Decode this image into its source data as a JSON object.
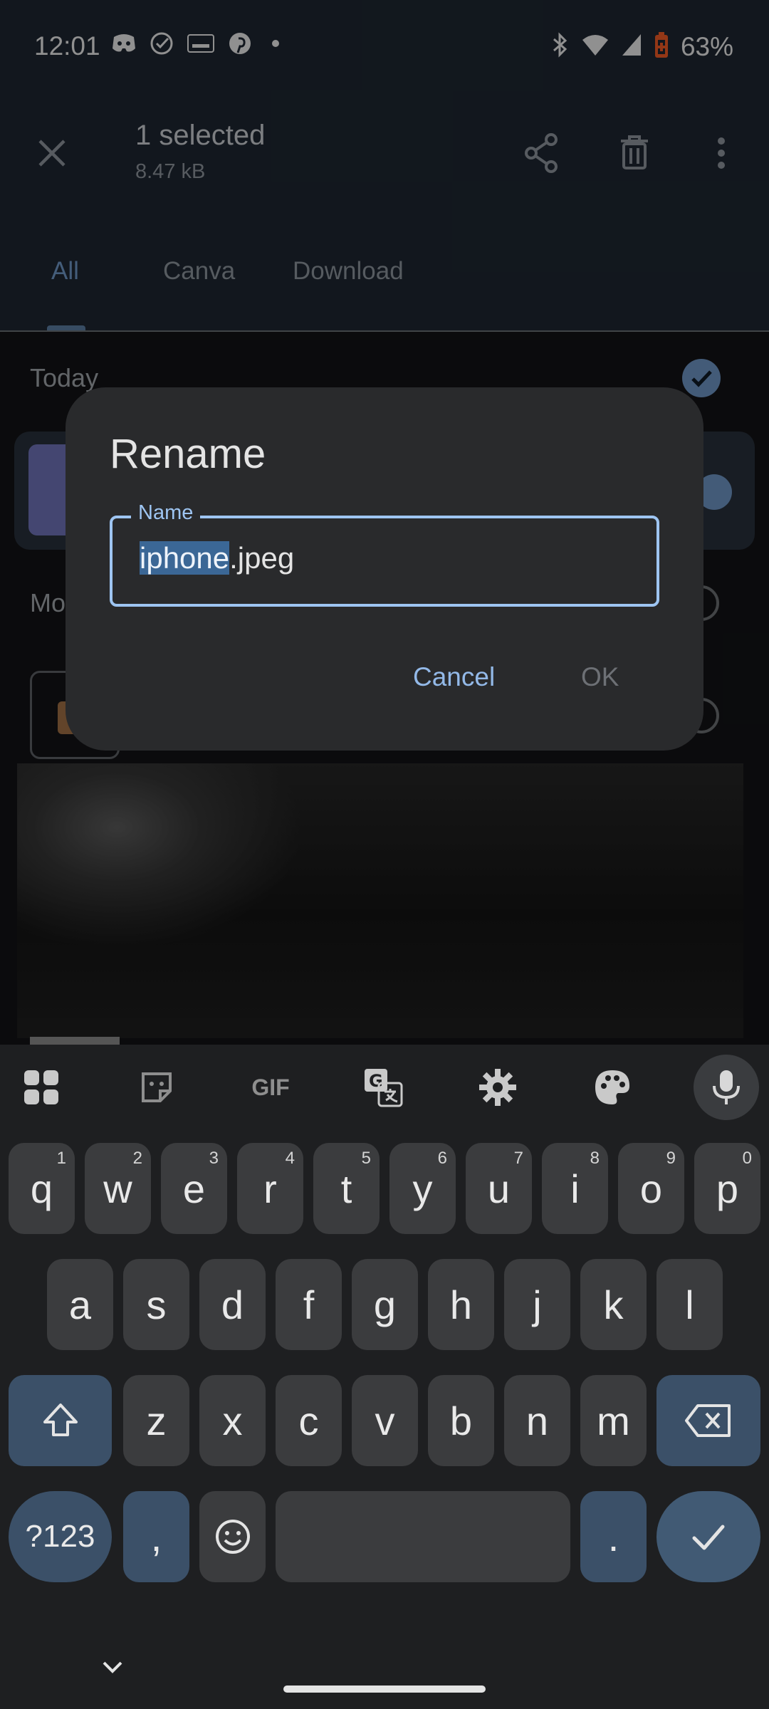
{
  "status_bar": {
    "time": "12:01",
    "battery": "63%",
    "notification_icons": [
      "discord-icon",
      "check-circle-icon",
      "temu-icon",
      "pinterest-icon",
      "dot-icon"
    ],
    "system_icons": [
      "bluetooth-icon",
      "wifi-icon",
      "signal-icon",
      "battery-saver-icon"
    ]
  },
  "action_bar": {
    "title": "1 selected",
    "subtitle": "8.47 kB",
    "actions": [
      "close-icon",
      "share-icon",
      "delete-icon",
      "more-vert-icon"
    ]
  },
  "tabs": [
    {
      "label": "All",
      "active": true
    },
    {
      "label": "Canva",
      "active": false
    },
    {
      "label": "Download",
      "active": false
    }
  ],
  "list": {
    "section_today": "Today",
    "section_more": "Mo"
  },
  "dialog": {
    "title": "Rename",
    "field_label": "Name",
    "value_selected": "iphone",
    "value_rest": ".jpeg",
    "cancel_label": "Cancel",
    "ok_label": "OK"
  },
  "keyboard": {
    "toolbar": [
      "apps-grid-icon",
      "sticker-icon",
      "gif-icon",
      "translate-icon",
      "settings-icon",
      "palette-icon",
      "mic-icon"
    ],
    "gif_label": "GIF",
    "row1": [
      {
        "key": "q",
        "hint": "1"
      },
      {
        "key": "w",
        "hint": "2"
      },
      {
        "key": "e",
        "hint": "3"
      },
      {
        "key": "r",
        "hint": "4"
      },
      {
        "key": "t",
        "hint": "5"
      },
      {
        "key": "y",
        "hint": "6"
      },
      {
        "key": "u",
        "hint": "7"
      },
      {
        "key": "i",
        "hint": "8"
      },
      {
        "key": "o",
        "hint": "9"
      },
      {
        "key": "p",
        "hint": "0"
      }
    ],
    "row2": [
      "a",
      "s",
      "d",
      "f",
      "g",
      "h",
      "j",
      "k",
      "l"
    ],
    "row3": [
      "z",
      "x",
      "c",
      "v",
      "b",
      "n",
      "m"
    ],
    "symbols_label": "?123",
    "comma_label": ",",
    "period_label": "."
  },
  "colors": {
    "accent": "#9ec5f2",
    "selection": "#3b6796",
    "dialog_bg": "#292a2c",
    "keyboard_bg": "#1e1f21"
  }
}
